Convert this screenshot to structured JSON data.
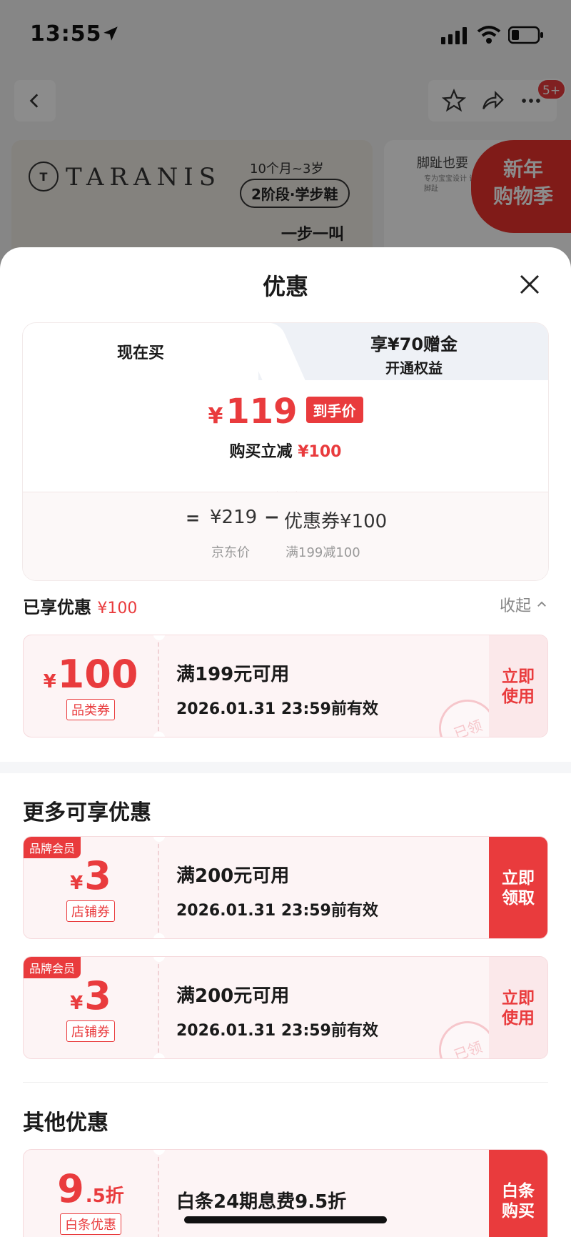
{
  "status_bar": {
    "time": "13:55"
  },
  "nav": {
    "badge": "5+"
  },
  "banner": {
    "brand_logo": "T",
    "brand_name": "TARANIS",
    "age": "10个月~3岁",
    "stage": "2阶段·学步鞋",
    "slogan": "一步一叫",
    "right_title": "脚趾也要",
    "right_sub": "专为宝宝设计 让发育中的脚趾",
    "promo": "新年购物季"
  },
  "sheet": {
    "title": "优惠",
    "tabs": [
      {
        "label": "现在买"
      },
      {
        "line1": "享¥70赠金",
        "line2": "开通权益"
      }
    ],
    "price": {
      "yen": "¥",
      "value": "119",
      "tag": "到手价",
      "sub_label": "购买立减",
      "sub_value": "¥100"
    },
    "calc": {
      "eq": "=",
      "price": "¥219",
      "price_label": "京东价",
      "minus": "−",
      "coupon": "优惠券¥100",
      "coupon_label": "满199减100"
    },
    "enjoyed": {
      "label": "已享优惠",
      "value": "¥100",
      "collapse": "收起"
    },
    "coupons_enjoyed": [
      {
        "yen": "¥",
        "amount": "100",
        "type": "品类券",
        "cond": "满199元可用",
        "valid": "2026.01.31 23:59前有效",
        "action": "立即使用",
        "stamp": "已领"
      }
    ],
    "more_title": "更多可享优惠",
    "coupons_more": [
      {
        "member": "品牌会员",
        "yen": "¥",
        "amount": "3",
        "type": "店铺券",
        "cond": "满200元可用",
        "valid": "2026.01.31 23:59前有效",
        "action": "立即领取"
      },
      {
        "member": "品牌会员",
        "yen": "¥",
        "amount": "3",
        "type": "店铺券",
        "cond": "满200元可用",
        "valid": "2026.01.31 23:59前有效",
        "action": "立即使用",
        "stamp": "已领"
      }
    ],
    "other_title": "其他优惠",
    "coupons_other": [
      {
        "amount": "9",
        "suffix": ".5折",
        "type": "白条优惠",
        "cond": "白条24期息费9.5折",
        "action": "白条购买"
      }
    ]
  },
  "colors": {
    "accent": "#e93b3d",
    "coupon_bg": "#fdf4f5"
  }
}
